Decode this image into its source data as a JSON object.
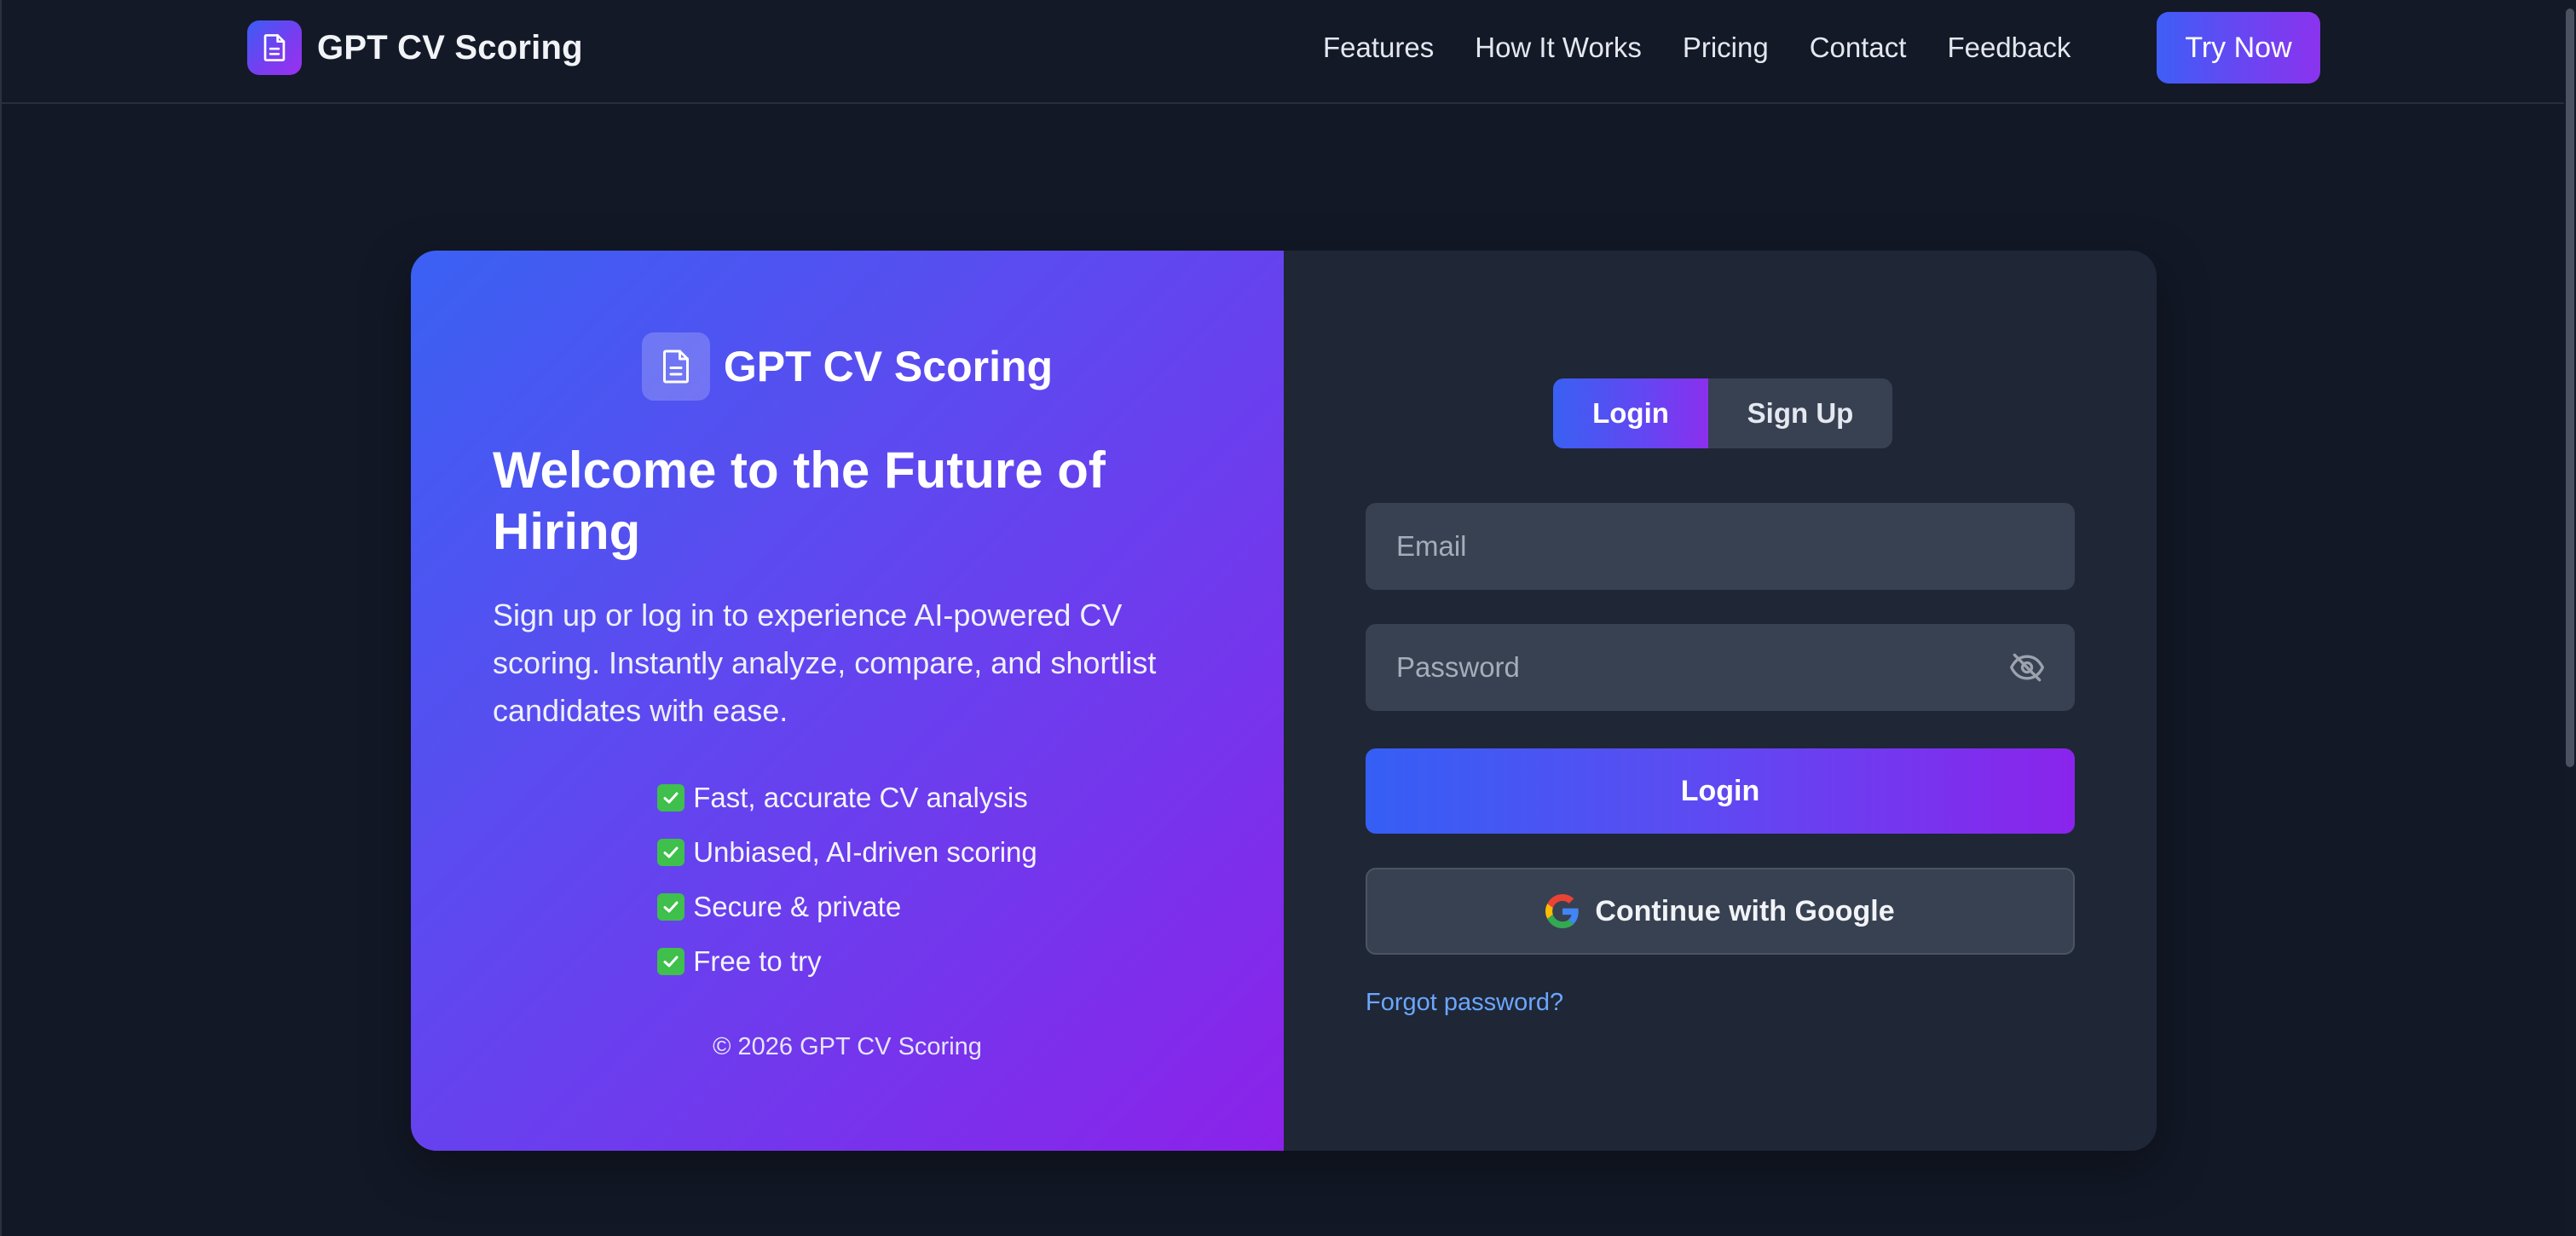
{
  "header": {
    "brand_title": "GPT CV Scoring",
    "nav": [
      "Features",
      "How It Works",
      "Pricing",
      "Contact",
      "Feedback"
    ],
    "cta_label": "Try Now"
  },
  "welcome_panel": {
    "brand_title": "GPT CV Scoring",
    "heading": "Welcome to the Future of Hiring",
    "description": "Sign up or log in to experience AI-powered CV scoring. Instantly analyze, compare, and shortlist candidates with ease.",
    "features": [
      "Fast, accurate CV analysis",
      "Unbiased, AI-driven scoring",
      "Secure & private",
      "Free to try"
    ],
    "copyright": "© 2026 GPT CV Scoring"
  },
  "auth_panel": {
    "tabs": [
      "Login",
      "Sign Up"
    ],
    "active_tab": "Login",
    "email_placeholder": "Email",
    "email_value": "",
    "password_placeholder": "Password",
    "password_value": "",
    "login_label": "Login",
    "google_label": "Continue with Google",
    "forgot_label": "Forgot password?"
  },
  "icons": {
    "brand": "document-icon",
    "feature_marker": "check-box-icon",
    "password_toggle": "eye-off-icon",
    "google": "google-icon"
  },
  "colors": {
    "page_bg": "#121826",
    "accent_start": "#3a60f3",
    "accent_end": "#8b2fee",
    "panel_bg": "#1f2636",
    "input_bg": "#374151",
    "link": "#6aa7ff"
  }
}
